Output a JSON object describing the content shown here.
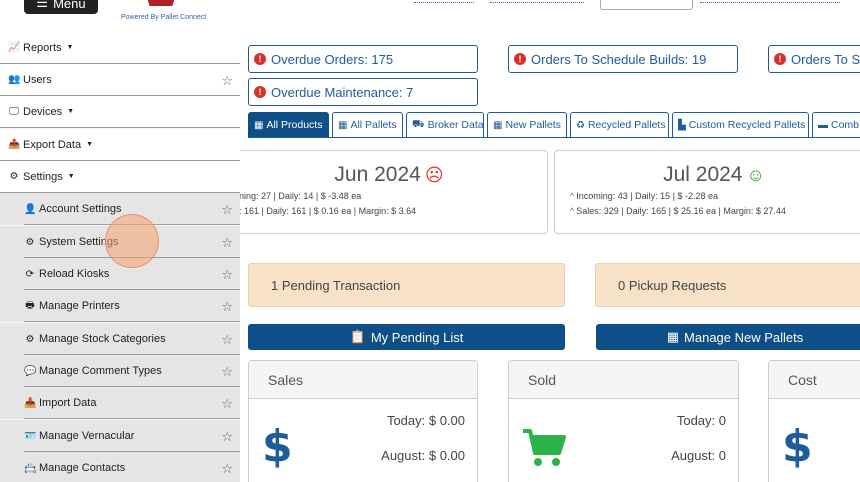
{
  "header": {
    "menu_label": "Menu",
    "powered_by": "Powered By Pallet Connect"
  },
  "sidebar": {
    "items": [
      {
        "label": "Reports",
        "icon": "bar-chart-icon",
        "glyph": "📈",
        "caret": true
      },
      {
        "label": "Users",
        "icon": "users-icon",
        "glyph": "👥",
        "star": true
      },
      {
        "label": "Devices",
        "icon": "monitor-icon",
        "glyph": "🖵",
        "caret": true
      },
      {
        "label": "Export Data",
        "icon": "file-export-icon",
        "glyph": "📤",
        "caret": true
      },
      {
        "label": "Settings",
        "icon": "cogs-icon",
        "glyph": "⚙",
        "caret": true
      }
    ],
    "subitems": [
      {
        "label": "Account Settings",
        "icon": "user-icon",
        "glyph": "👤"
      },
      {
        "label": "System Settings",
        "icon": "cogs-icon",
        "glyph": "⚙"
      },
      {
        "label": "Reload Kiosks",
        "icon": "refresh-icon",
        "glyph": "⟳"
      },
      {
        "label": "Manage Printers",
        "icon": "printer-icon",
        "glyph": "🖶"
      },
      {
        "label": "Manage Stock Categories",
        "icon": "cogs-icon",
        "glyph": "⚙"
      },
      {
        "label": "Manage Comment Types",
        "icon": "comments-icon",
        "glyph": "💬"
      },
      {
        "label": "Import Data",
        "icon": "file-import-icon",
        "glyph": "📥"
      },
      {
        "label": "Manage Vernacular",
        "icon": "id-card-icon",
        "glyph": "🪪"
      },
      {
        "label": "Manage Contacts",
        "icon": "address-book-icon",
        "glyph": "📇"
      }
    ]
  },
  "alerts": {
    "overdue_orders": "Overdue Orders: 175",
    "orders_to_schedule": "Orders To Schedule Builds: 19",
    "orders_to_s": "Orders To S",
    "overdue_maintenance": "Overdue Maintenance: 7"
  },
  "tabs": [
    {
      "label": "All Products",
      "active": true
    },
    {
      "label": "All Pallets"
    },
    {
      "label": "Broker Data"
    },
    {
      "label": "New Pallets"
    },
    {
      "label": "Recycled Pallets"
    },
    {
      "label": "Custom Recycled Pallets"
    },
    {
      "label": "Comb"
    }
  ],
  "months": [
    {
      "title": "Jun 2024",
      "mood": "frown",
      "incoming": "ning: 27 | Daily: 14 | $ -3.48 ea",
      "sales": ": 161 | Daily: 161 | $ 0.16 ea | Margin: $ 3.64"
    },
    {
      "title": "Jul 2024",
      "mood": "smile",
      "incoming": "Incoming: 43 | Daily: 15 | $ -2.28 ea",
      "sales": "Sales: 329 | Daily: 165 | $ 25.16 ea | Margin: $ 27.44"
    }
  ],
  "pending": {
    "transactions": "1 Pending Transaction",
    "pickups": "0 Pickup Requests"
  },
  "buttons": {
    "my_pending_list": "My Pending List",
    "manage_new_pallets": "Manage New Pallets"
  },
  "stats": {
    "sales": {
      "title": "Sales",
      "today": "Today: $ 0.00",
      "month": "August: $ 0.00",
      "symbol": "$"
    },
    "sold": {
      "title": "Sold",
      "today": "Today: 0",
      "month": "August: 0"
    },
    "cost": {
      "title": "Cost",
      "symbol": "$"
    }
  },
  "colors": {
    "primary": "#0e4f88",
    "link": "#1f5c9a",
    "alert_dot": "#d9302c",
    "pending_bg": "#f7e1c7",
    "cart_green": "#2bb34a"
  }
}
